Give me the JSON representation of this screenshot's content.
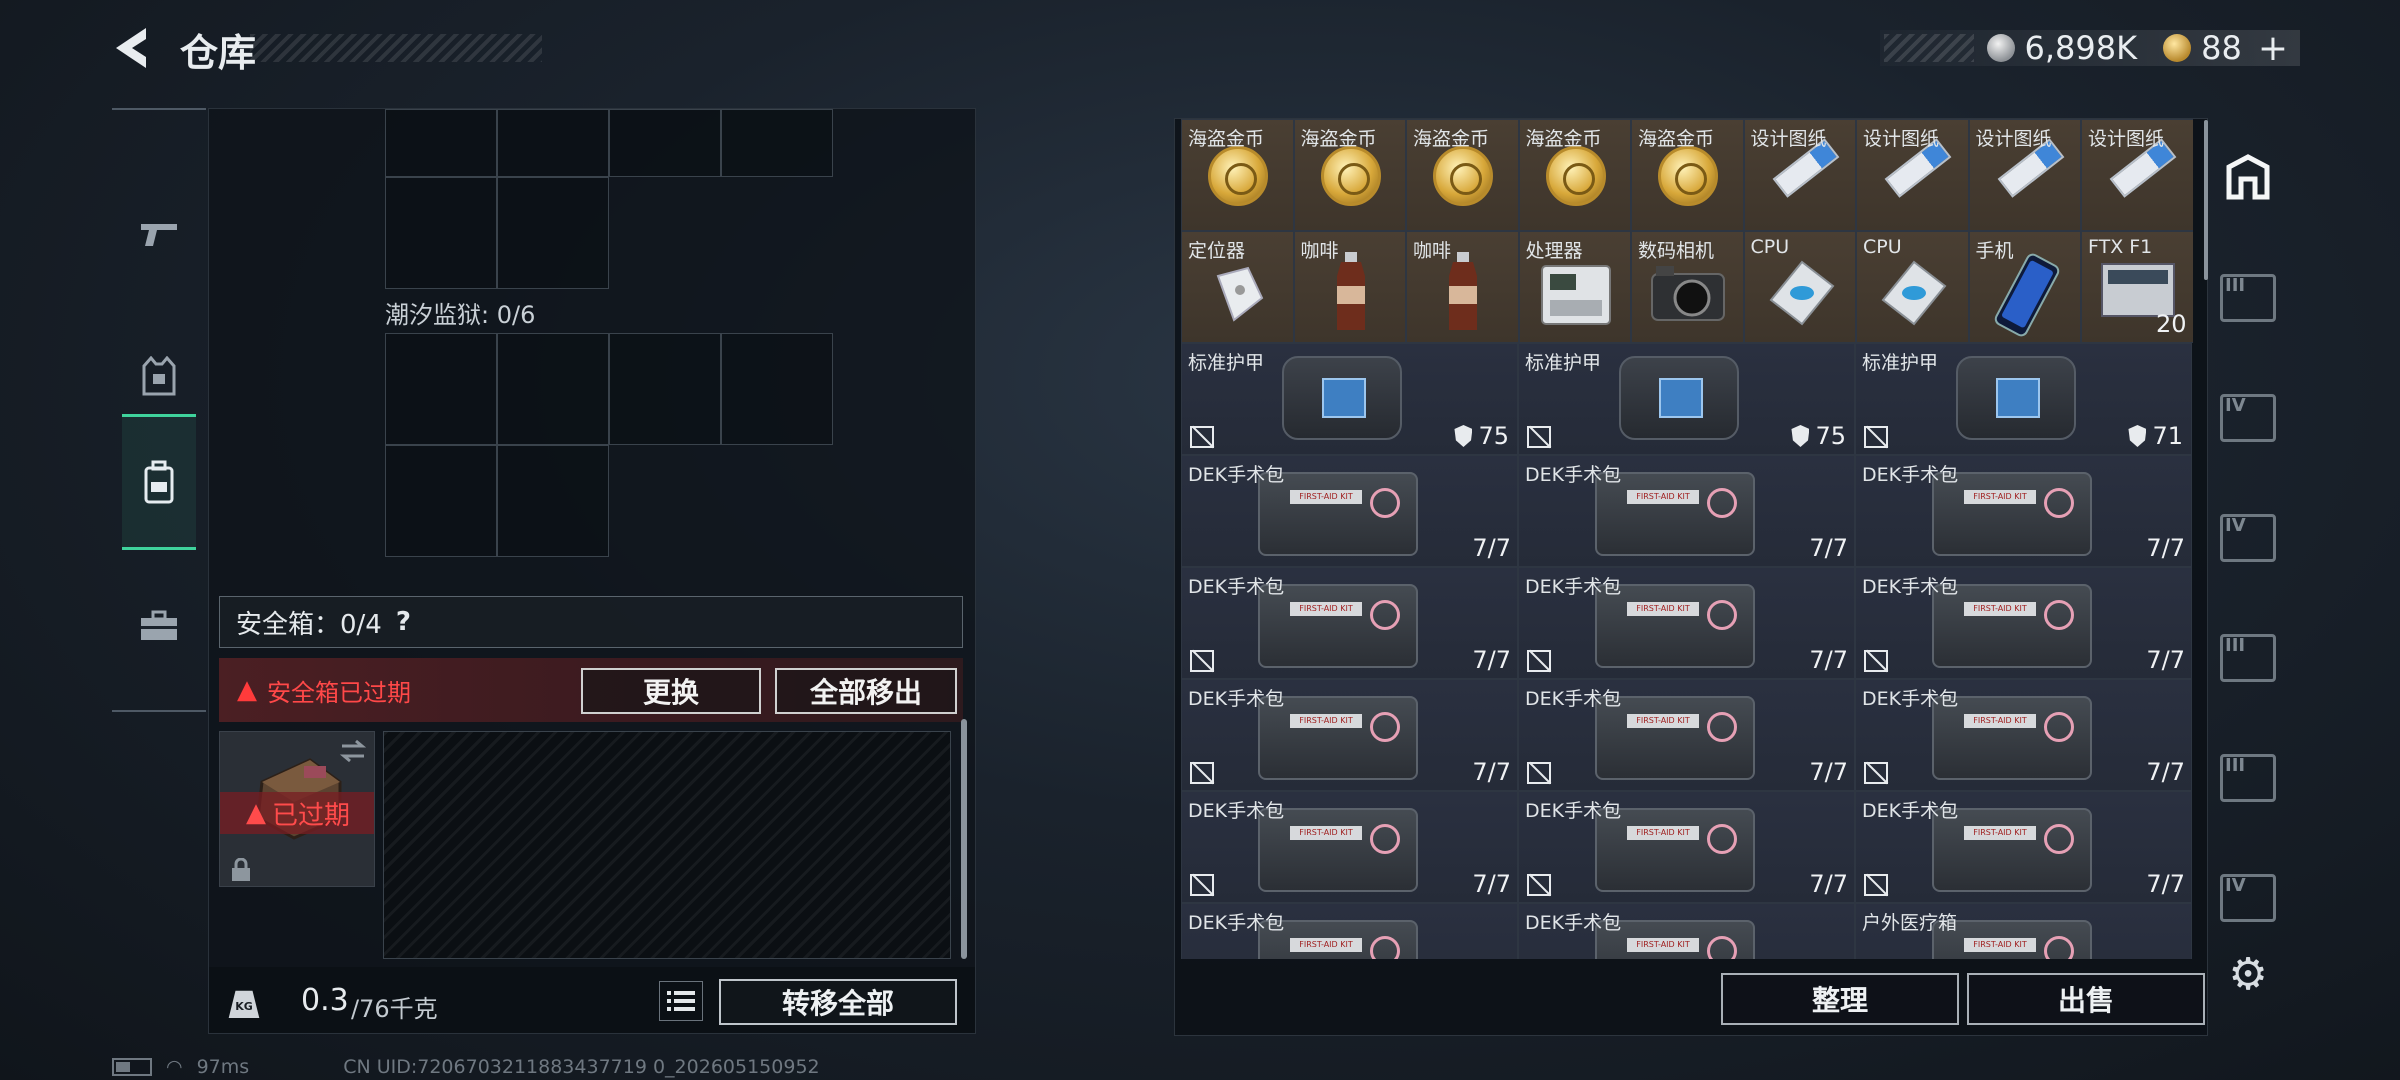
{
  "header": {
    "title": "仓库",
    "silver_amount": "6,898K",
    "gold_amount": "88",
    "plus": "+"
  },
  "left_nav": {
    "items": [
      {
        "name": "weapon",
        "icon": "pistol-icon"
      },
      {
        "name": "equipment",
        "icon": "vest-icon"
      },
      {
        "name": "backpack",
        "icon": "backpack-icon",
        "active": true
      },
      {
        "name": "case",
        "icon": "briefcase-icon"
      }
    ]
  },
  "container": {
    "section_label": "潮汐监狱: 0/6",
    "safe_box_label": "安全箱：0/4",
    "help": "?",
    "expired_warning": "安全箱已过期",
    "replace_button": "更换",
    "remove_all_button": "全部移出",
    "case_expired_tag": "已过期",
    "weight_value": "0.3",
    "weight_max": "/76千克",
    "kg_label": "KG",
    "transfer_all_button": "转移全部"
  },
  "inventory": {
    "row1": [
      {
        "name": "海盗金币",
        "art": "coin"
      },
      {
        "name": "海盗金币",
        "art": "coin"
      },
      {
        "name": "海盗金币",
        "art": "coin"
      },
      {
        "name": "海盗金币",
        "art": "coin"
      },
      {
        "name": "海盗金币",
        "art": "coin"
      },
      {
        "name": "设计图纸",
        "art": "blueprint"
      },
      {
        "name": "设计图纸",
        "art": "blueprint"
      },
      {
        "name": "设计图纸",
        "art": "blueprint"
      },
      {
        "name": "设计图纸",
        "art": "blueprint"
      }
    ],
    "row2": [
      {
        "name": "定位器",
        "art": "locator"
      },
      {
        "name": "咖啡",
        "art": "coffee"
      },
      {
        "name": "咖啡",
        "art": "coffee"
      },
      {
        "name": "处理器",
        "art": "processor"
      },
      {
        "name": "数码相机",
        "art": "camera"
      },
      {
        "name": "CPU",
        "art": "cpu"
      },
      {
        "name": "CPU",
        "art": "cpu"
      },
      {
        "name": "手机",
        "art": "phone"
      },
      {
        "name": "FTX F1",
        "art": "ftx",
        "qty": "20"
      }
    ],
    "armor": [
      {
        "name": "标准护甲",
        "value": "75"
      },
      {
        "name": "标准护甲",
        "value": "75"
      },
      {
        "name": "标准护甲",
        "value": "71"
      }
    ],
    "kit_rows": [
      [
        {
          "name": "DEK手术包",
          "qty": "7/7"
        },
        {
          "name": "DEK手术包",
          "qty": "7/7"
        },
        {
          "name": "DEK手术包",
          "qty": "7/7"
        }
      ],
      [
        {
          "name": "DEK手术包",
          "qty": "7/7"
        },
        {
          "name": "DEK手术包",
          "qty": "7/7"
        },
        {
          "name": "DEK手术包",
          "qty": "7/7"
        }
      ],
      [
        {
          "name": "DEK手术包",
          "qty": "7/7"
        },
        {
          "name": "DEK手术包",
          "qty": "7/7"
        },
        {
          "name": "DEK手术包",
          "qty": "7/7"
        }
      ],
      [
        {
          "name": "DEK手术包",
          "qty": "7/7"
        },
        {
          "name": "DEK手术包",
          "qty": "7/7"
        },
        {
          "name": "DEK手术包",
          "qty": "7/7"
        }
      ],
      [
        {
          "name": "DEK手术包",
          "qty": ""
        },
        {
          "name": "DEK手术包",
          "qty": ""
        },
        {
          "name": "户外医疗箱",
          "qty": ""
        }
      ]
    ],
    "kit_label": "FIRST-AID KIT"
  },
  "right_tabs": [
    {
      "name": "all",
      "label": "",
      "active": true
    },
    {
      "name": "tier-3-a",
      "label": "III"
    },
    {
      "name": "tier-4-a",
      "label": "IV"
    },
    {
      "name": "tier-4-b",
      "label": "IV"
    },
    {
      "name": "tier-3-b",
      "label": "III"
    },
    {
      "name": "tier-3-c",
      "label": "III"
    },
    {
      "name": "tier-4-c",
      "label": "IV"
    }
  ],
  "actions": {
    "sort_button": "整理",
    "sell_button": "出售"
  },
  "footer": {
    "ping": "97ms",
    "uid": "CN UID:7206703211883437719 0_202605150952"
  }
}
